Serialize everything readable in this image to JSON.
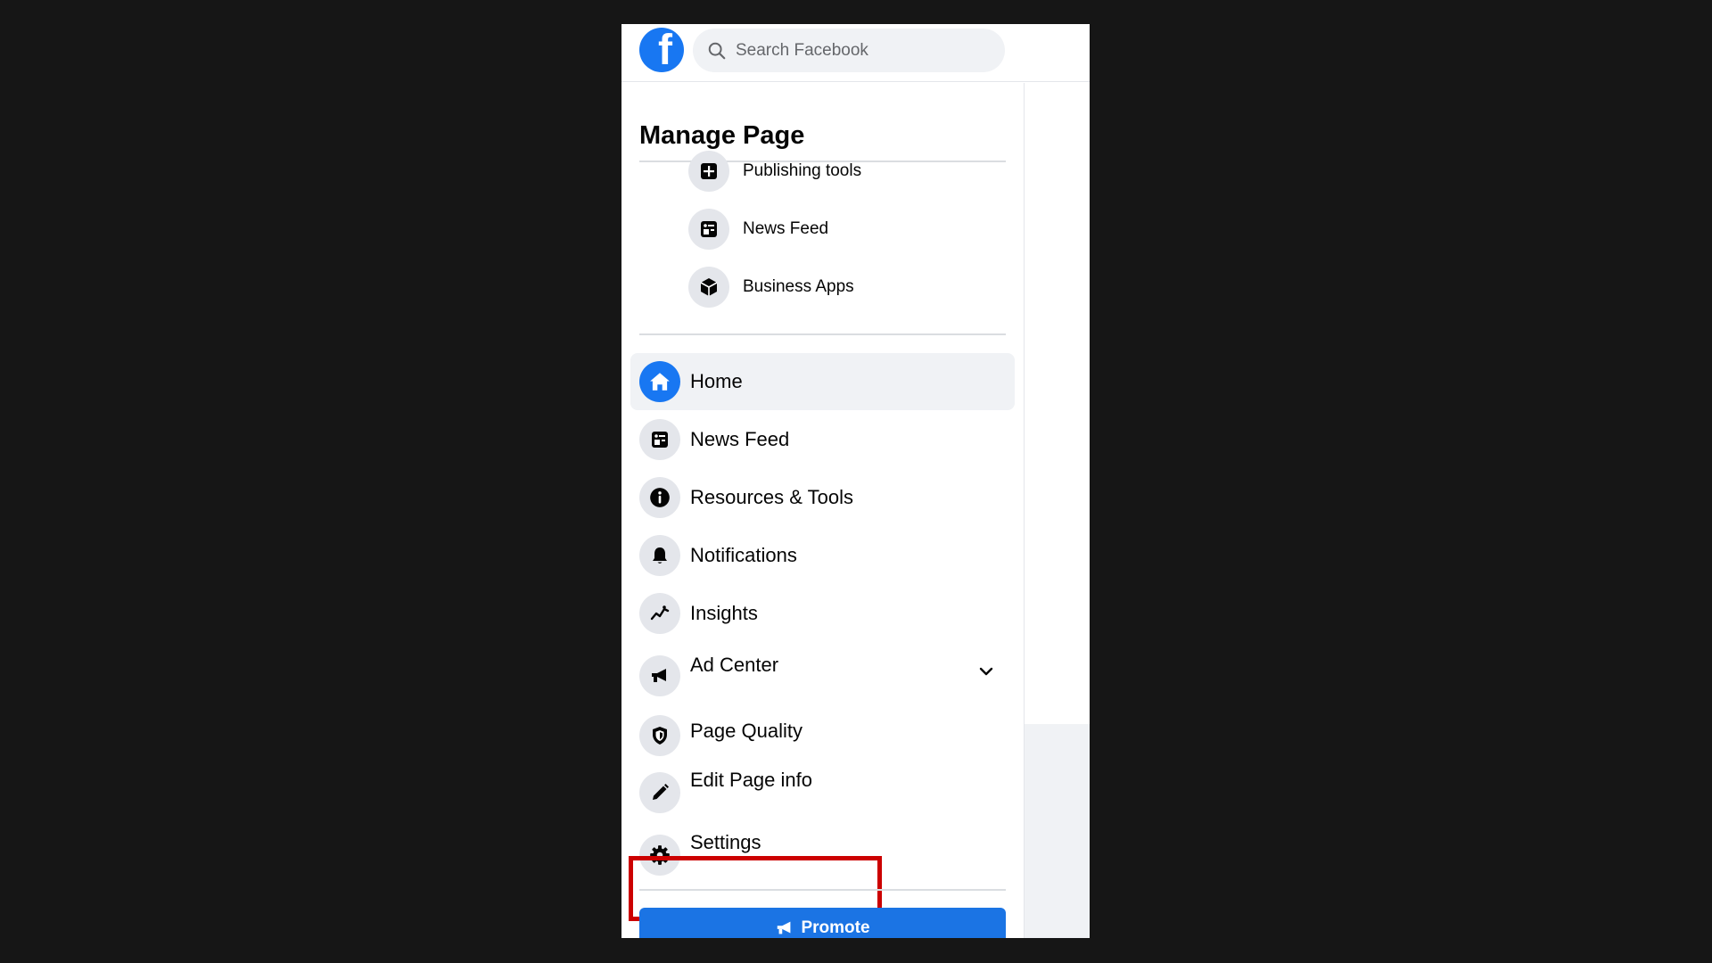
{
  "header": {
    "logo_icon": "facebook-logo-icon",
    "logo_letter": "f",
    "search_placeholder": "Search Facebook",
    "brand_color": "#1877f2"
  },
  "sidebar": {
    "title": "Manage Page",
    "sub_items": [
      {
        "label": "Publishing tools",
        "icon": "publishing-tools-icon"
      },
      {
        "label": "News Feed",
        "icon": "news-feed-icon"
      },
      {
        "label": "Business Apps",
        "icon": "business-apps-icon"
      }
    ],
    "nav_items": [
      {
        "label": "Home",
        "icon": "home-icon",
        "active": true
      },
      {
        "label": "News Feed",
        "icon": "news-feed-icon"
      },
      {
        "label": "Resources & Tools",
        "icon": "info-icon"
      },
      {
        "label": "Notifications",
        "icon": "bell-icon"
      },
      {
        "label": "Insights",
        "icon": "insights-icon"
      },
      {
        "label": "Ad Center",
        "icon": "megaphone-icon",
        "expandable": true
      },
      {
        "label": "Page Quality",
        "icon": "shield-icon"
      },
      {
        "label": "Edit Page info",
        "icon": "pencil-icon"
      },
      {
        "label": "Settings",
        "icon": "gear-icon",
        "highlighted": true
      }
    ],
    "promote_label": "Promote",
    "highlight_color": "#cc0000"
  }
}
